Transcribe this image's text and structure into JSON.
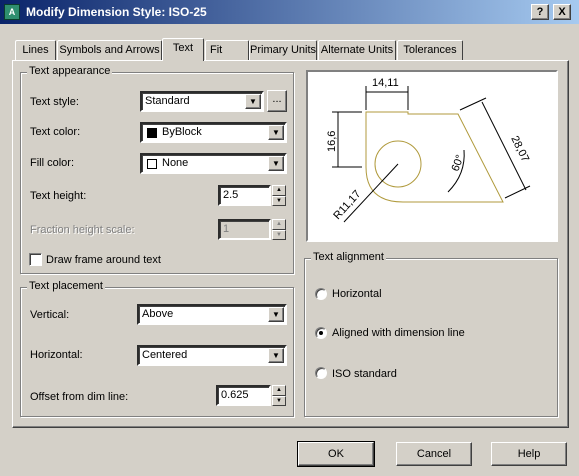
{
  "window": {
    "title": "Modify Dimension Style: ISO-25",
    "help_glyph": "?",
    "close_glyph": "X"
  },
  "tabs": [
    {
      "label": "Lines"
    },
    {
      "label": "Symbols and Arrows"
    },
    {
      "label": "Text"
    },
    {
      "label": "Fit"
    },
    {
      "label": "Primary Units"
    },
    {
      "label": "Alternate Units"
    },
    {
      "label": "Tolerances"
    }
  ],
  "active_tab": "Text",
  "text_appearance": {
    "group_label": "Text appearance",
    "text_style_label": "Text style:",
    "text_style_value": "Standard",
    "text_style_browse": "...",
    "text_color_label": "Text color:",
    "text_color_value": "ByBlock",
    "text_color_swatch": "#000000",
    "fill_color_label": "Fill color:",
    "fill_color_value": "None",
    "fill_color_swatch": "#ffffff",
    "text_height_label": "Text height:",
    "text_height_value": "2.5",
    "fraction_label": "Fraction height scale:",
    "fraction_value": "1",
    "draw_frame_label": "Draw frame around text",
    "draw_frame_checked": false
  },
  "text_placement": {
    "group_label": "Text placement",
    "vertical_label": "Vertical:",
    "vertical_value": "Above",
    "horizontal_label": "Horizontal:",
    "horizontal_value": "Centered",
    "offset_label": "Offset from dim line:",
    "offset_value": "0.625"
  },
  "preview": {
    "dim_top": "14,11",
    "dim_left": "16,6",
    "dim_right": "28,07",
    "dim_angle": "60°",
    "dim_radius": "R11,17",
    "geometry_color": "#b09a3c"
  },
  "text_alignment": {
    "group_label": "Text alignment",
    "options": [
      {
        "label": "Horizontal",
        "selected": false
      },
      {
        "label": "Aligned with dimension line",
        "selected": true
      },
      {
        "label": "ISO standard",
        "selected": false
      }
    ]
  },
  "buttons": {
    "ok": "OK",
    "cancel": "Cancel",
    "help": "Help"
  },
  "glyphs": {
    "dropdown": "▼",
    "spin_up": "▲",
    "spin_down": "▼"
  }
}
